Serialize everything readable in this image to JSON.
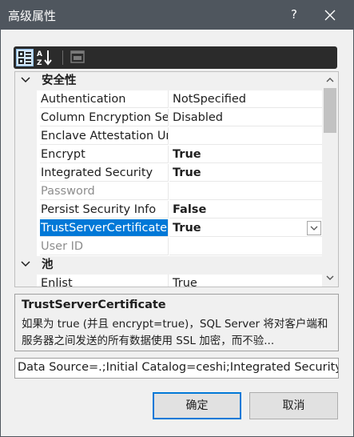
{
  "window": {
    "title": "高级属性",
    "help": "?",
    "close_icon": "close-icon"
  },
  "toolbar": {
    "buttons": [
      "categorized-icon",
      "alphabetical-icon",
      "property-pages-icon"
    ]
  },
  "grid": {
    "categories": [
      {
        "label": "安全性",
        "rows": [
          {
            "name": "Authentication",
            "value": "NotSpecified",
            "bold": false
          },
          {
            "name": "Column Encryption Se",
            "value": "Disabled",
            "bold": false
          },
          {
            "name": "Enclave Attestation Ur",
            "value": "",
            "bold": false
          },
          {
            "name": "Encrypt",
            "value": "True",
            "bold": true
          },
          {
            "name": "Integrated Security",
            "value": "True",
            "bold": true
          },
          {
            "name": "Password",
            "value": "",
            "bold": false
          },
          {
            "name": "Persist Security Info",
            "value": "False",
            "bold": true
          },
          {
            "name": "TrustServerCertificate",
            "value": "True",
            "bold": true
          },
          {
            "name": "User ID",
            "value": "",
            "bold": false
          }
        ]
      },
      {
        "label": "池",
        "rows": [
          {
            "name": "Enlist",
            "value": "True",
            "bold": false
          }
        ]
      }
    ]
  },
  "description": {
    "title": "TrustServerCertificate",
    "text": "如果为 true (并且 encrypt=true)，SQL Server 将对客户端和服务器之间发送的所有数据使用 SSL 加密，而不验..."
  },
  "connection_string": "Data Source=.;Initial Catalog=ceshi;Integrated Security",
  "buttons": {
    "ok": "确定",
    "cancel": "取消"
  },
  "colors": {
    "titlebar": "#4f565e",
    "selection": "#0078d7",
    "background": "#f0f0f0"
  }
}
